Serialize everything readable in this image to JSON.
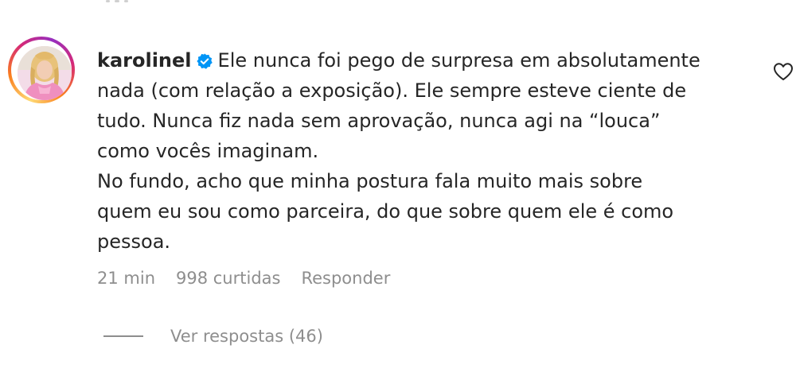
{
  "comment": {
    "username": "karolinel",
    "verified": true,
    "lines": [
      "Ele nunca foi pego de surpresa em absolutamente",
      "nada (com relação a exposição). Ele sempre esteve ciente de",
      "tudo. Nunca fiz nada sem aprovação, nunca agi na “louca”",
      "como vocês imaginam.",
      "No fundo, acho que minha postura fala muito mais sobre",
      "quem eu sou como parceira, do que sobre quem ele é como",
      "pessoa."
    ],
    "time": "21 min",
    "likes": "998 curtidas",
    "reply_label": "Responder",
    "view_replies_label": "Ver respostas (46)"
  },
  "icons": {
    "verified": "verified-badge-icon",
    "like": "heart-outline-icon"
  },
  "colors": {
    "text": "#262626",
    "secondary_text": "#8e8e8e",
    "verified_blue": "#0095f6",
    "ring_gradient": [
      "#feda75",
      "#fa7e1e",
      "#d62976",
      "#962fbf"
    ]
  }
}
